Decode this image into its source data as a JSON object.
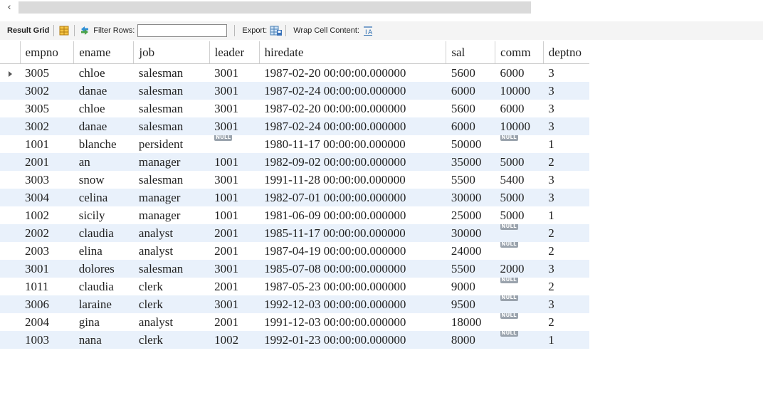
{
  "scrollbar": {
    "left_arrow": "‹"
  },
  "toolbar": {
    "result_grid_label": "Result Grid",
    "filter_rows_label": "Filter Rows:",
    "filter_value": "",
    "export_label": "Export:",
    "wrap_label": "Wrap Cell Content:",
    "icons": [
      "form-view-icon",
      "refresh-icon",
      "export-icon",
      "wrap-cell-icon"
    ]
  },
  "null_text": "NULL",
  "grid": {
    "columns": [
      "empno",
      "ename",
      "job",
      "leader",
      "hiredate",
      "sal",
      "comm",
      "deptno"
    ],
    "rows": [
      [
        "3005",
        "chloe",
        "salesman",
        "3001",
        "1987-02-20 00:00:00.000000",
        "5600",
        "6000",
        "3"
      ],
      [
        "3002",
        "danae",
        "salesman",
        "3001",
        "1987-02-24 00:00:00.000000",
        "6000",
        "10000",
        "3"
      ],
      [
        "3005",
        "chloe",
        "salesman",
        "3001",
        "1987-02-20 00:00:00.000000",
        "5600",
        "6000",
        "3"
      ],
      [
        "3002",
        "danae",
        "salesman",
        "3001",
        "1987-02-24 00:00:00.000000",
        "6000",
        "10000",
        "3"
      ],
      [
        "1001",
        "blanche",
        "persident",
        null,
        "1980-11-17 00:00:00.000000",
        "50000",
        null,
        "1"
      ],
      [
        "2001",
        "an",
        "manager",
        "1001",
        "1982-09-02 00:00:00.000000",
        "35000",
        "5000",
        "2"
      ],
      [
        "3003",
        "snow",
        "salesman",
        "3001",
        "1991-11-28 00:00:00.000000",
        "5500",
        "5400",
        "3"
      ],
      [
        "3004",
        "celina",
        "manager",
        "1001",
        "1982-07-01 00:00:00.000000",
        "30000",
        "5000",
        "3"
      ],
      [
        "1002",
        "sicily",
        "manager",
        "1001",
        "1981-06-09 00:00:00.000000",
        "25000",
        "5000",
        "1"
      ],
      [
        "2002",
        "claudia",
        "analyst",
        "2001",
        "1985-11-17 00:00:00.000000",
        "30000",
        null,
        "2"
      ],
      [
        "2003",
        "elina",
        "analyst",
        "2001",
        "1987-04-19 00:00:00.000000",
        "24000",
        null,
        "2"
      ],
      [
        "3001",
        "dolores",
        "salesman",
        "3001",
        "1985-07-08 00:00:00.000000",
        "5500",
        "2000",
        "3"
      ],
      [
        "1011",
        "claudia",
        "clerk",
        "2001",
        "1987-05-23 00:00:00.000000",
        "9000",
        null,
        "2"
      ],
      [
        "3006",
        "laraine",
        "clerk",
        "3001",
        "1992-12-03 00:00:00.000000",
        "9500",
        null,
        "3"
      ],
      [
        "2004",
        "gina",
        "analyst",
        "2001",
        "1991-12-03 00:00:00.000000",
        "18000",
        null,
        "2"
      ],
      [
        "1003",
        "nana",
        "clerk",
        "1002",
        "1992-01-23 00:00:00.000000",
        "8000",
        null,
        "1"
      ]
    ],
    "current_row_index": 0
  }
}
